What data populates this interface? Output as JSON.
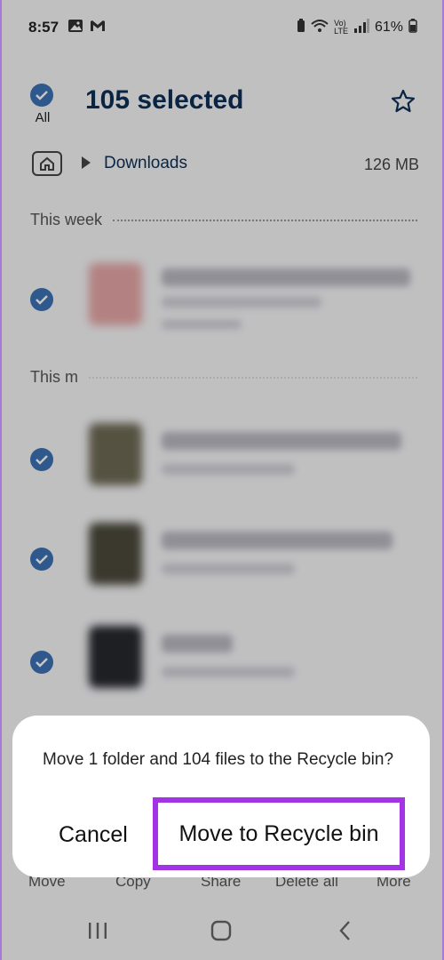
{
  "status_bar": {
    "time": "8:57",
    "battery": "61%"
  },
  "header": {
    "select_all_label": "All",
    "title": "105 selected"
  },
  "path": {
    "folder": "Downloads",
    "size": "126 MB"
  },
  "sections": {
    "this_week": "This week",
    "this_month_partial": "This m"
  },
  "dialog": {
    "message": "Move 1 folder and 104 files to the Recycle bin?",
    "cancel_label": "Cancel",
    "confirm_label": "Move to Recycle bin",
    "highlight_color": "#a234e6"
  },
  "bottom_actions": {
    "move": "Move",
    "copy": "Copy",
    "share": "Share",
    "delete_all": "Delete all",
    "more": "More"
  },
  "colors": {
    "accent": "#3d72b4",
    "title": "#0e2f57"
  }
}
